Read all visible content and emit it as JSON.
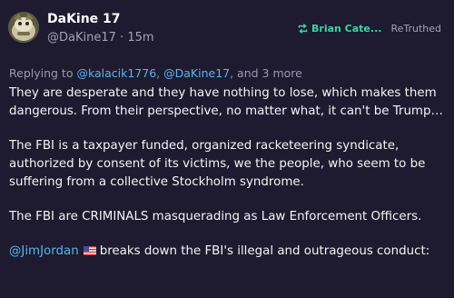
{
  "post": {
    "author": {
      "display_name": "DaKine 17",
      "handle": "@DaKine17",
      "separator": " · ",
      "time": "15m",
      "avatar_icon": "avatar-image"
    },
    "retruth": {
      "icon": "retruth-icon",
      "name": "Brian Cate...",
      "label": "ReTruthed",
      "color": "#3fd2a3"
    },
    "replying": {
      "prefix": "Replying to ",
      "mention_1": "@kalacik1776",
      "comma": ", ",
      "mention_2": "@DaKine17",
      "suffix": ", and 3 more"
    },
    "paragraphs": {
      "p1": "They are desperate and they have nothing to lose, which makes them dangerous.  From their perspective, no matter what, it can't be Trump…",
      "p2": "The FBI is a taxpayer funded, organized racketeering syndicate, authorized by consent of its victims, we the people, who seem to be suffering from a collective Stockholm syndrome.",
      "p3": "The FBI are CRIMINALS masquerading as Law Enforcement Officers.",
      "p4_mention": "@JimJordan",
      "p4_flag_icon": "us-flag-icon",
      "p4_text": "breaks down the FBI's illegal and outrageous conduct:"
    }
  },
  "colors": {
    "background": "#1e1b31",
    "mention": "#58b5e8",
    "secondary_text": "#a3a2b5"
  }
}
